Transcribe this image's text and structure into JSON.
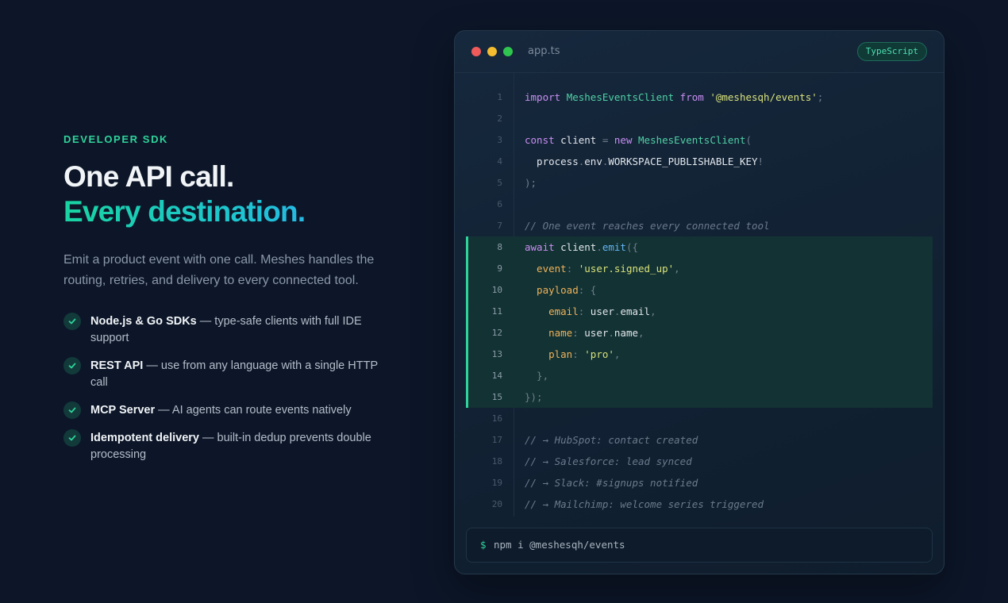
{
  "hero": {
    "eyebrow": "DEVELOPER SDK",
    "title_line1": "One API call.",
    "title_line2": "Every destination.",
    "description": "Emit a product event with one call. Meshes handles the routing, retries, and delivery to every connected tool.",
    "features": [
      {
        "title": "Node.js & Go SDKs",
        "text": " — type-safe clients with full IDE support"
      },
      {
        "title": "REST API",
        "text": " — use from any language with a single HTTP call"
      },
      {
        "title": "MCP Server",
        "text": " — AI agents can route events natively"
      },
      {
        "title": "Idempotent delivery",
        "text": " — built-in dedup prevents double processing"
      }
    ]
  },
  "editor": {
    "filename": "app.ts",
    "language": "TypeScript",
    "highlight_lines": [
      8,
      15
    ],
    "lines": [
      [
        [
          "k",
          "import "
        ],
        [
          "c",
          "MeshesEventsClient"
        ],
        [
          "k",
          " from "
        ],
        [
          "s",
          "'@meshesqh/events'"
        ],
        [
          "p",
          ";"
        ]
      ],
      [],
      [
        [
          "k",
          "const "
        ],
        [
          "id",
          "client "
        ],
        [
          "p",
          "= "
        ],
        [
          "k",
          "new "
        ],
        [
          "c",
          "MeshesEventsClient"
        ],
        [
          "p",
          "("
        ]
      ],
      [
        [
          "id",
          "  process"
        ],
        [
          "p",
          "."
        ],
        [
          "id",
          "env"
        ],
        [
          "p",
          "."
        ],
        [
          "id",
          "WORKSPACE_PUBLISHABLE_KEY"
        ],
        [
          "p",
          "!"
        ]
      ],
      [
        [
          "p",
          ");"
        ]
      ],
      [],
      [
        [
          "cm",
          "// One event reaches every connected tool"
        ]
      ],
      [
        [
          "k",
          "await "
        ],
        [
          "id",
          "client"
        ],
        [
          "p",
          "."
        ],
        [
          "f",
          "emit"
        ],
        [
          "p",
          "({"
        ]
      ],
      [
        [
          "prop",
          "  event"
        ],
        [
          "p",
          ": "
        ],
        [
          "s",
          "'user.signed_up'"
        ],
        [
          "p",
          ","
        ]
      ],
      [
        [
          "prop",
          "  payload"
        ],
        [
          "p",
          ": {"
        ]
      ],
      [
        [
          "prop",
          "    email"
        ],
        [
          "p",
          ": "
        ],
        [
          "id",
          "user"
        ],
        [
          "p",
          "."
        ],
        [
          "id",
          "email"
        ],
        [
          "p",
          ","
        ]
      ],
      [
        [
          "prop",
          "    name"
        ],
        [
          "p",
          ": "
        ],
        [
          "id",
          "user"
        ],
        [
          "p",
          "."
        ],
        [
          "id",
          "name"
        ],
        [
          "p",
          ","
        ]
      ],
      [
        [
          "prop",
          "    plan"
        ],
        [
          "p",
          ": "
        ],
        [
          "s",
          "'pro'"
        ],
        [
          "p",
          ","
        ]
      ],
      [
        [
          "p",
          "  },"
        ]
      ],
      [
        [
          "p",
          "});"
        ]
      ],
      [],
      [
        [
          "cm",
          "// → HubSpot: contact created"
        ]
      ],
      [
        [
          "cm",
          "// → Salesforce: lead synced"
        ]
      ],
      [
        [
          "cm",
          "// → Slack: #signups notified"
        ]
      ],
      [
        [
          "cm",
          "// → Mailchimp: welcome series triggered"
        ]
      ]
    ],
    "terminal_prompt": "$",
    "terminal_command": "npm i @meshesqh/events"
  },
  "colors": {
    "accent_green": "#2fd39a",
    "gradient": [
      "#19d3a2",
      "#3aa2ff"
    ],
    "background": "#0c1628"
  },
  "icons": {
    "feature_icon": "check-icon",
    "window_controls": [
      "close-dot-icon",
      "minimize-dot-icon",
      "maximize-dot-icon"
    ]
  }
}
